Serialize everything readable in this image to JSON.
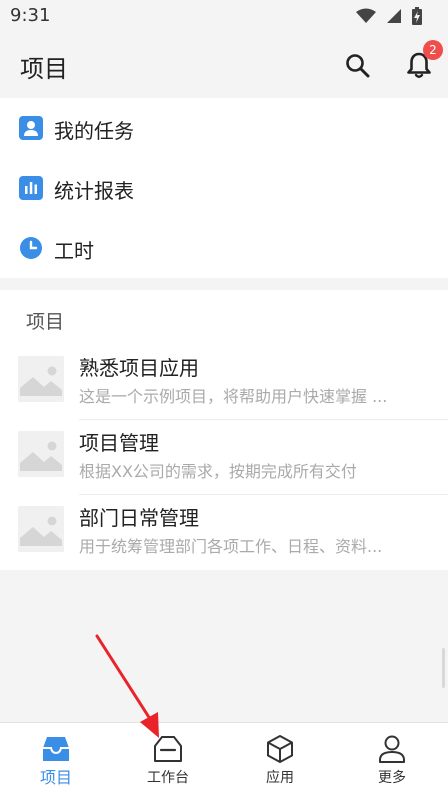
{
  "status_bar": {
    "time": "9:31"
  },
  "header": {
    "title": "项目",
    "notification_count": "2"
  },
  "menu": {
    "items": [
      {
        "label": "我的任务",
        "icon": "person-icon"
      },
      {
        "label": "统计报表",
        "icon": "bar-chart-icon"
      },
      {
        "label": "工时",
        "icon": "clock-icon"
      }
    ]
  },
  "projects": {
    "section_title": "项目",
    "items": [
      {
        "name": "熟悉项目应用",
        "description": "这是一个示例项目，将帮助用户快速掌握 ..."
      },
      {
        "name": "项目管理",
        "description": "根据XX公司的需求，按期完成所有交付"
      },
      {
        "name": "部门日常管理",
        "description": "用于统筹管理部门各项工作、日程、资料..."
      }
    ]
  },
  "bottom_nav": {
    "items": [
      {
        "label": "项目",
        "icon": "inbox-icon",
        "active": true
      },
      {
        "label": "工作台",
        "icon": "workbench-icon",
        "active": false
      },
      {
        "label": "应用",
        "icon": "cube-icon",
        "active": false
      },
      {
        "label": "更多",
        "icon": "user-icon",
        "active": false
      }
    ]
  },
  "colors": {
    "accent": "#3a8ee6",
    "badge": "#f04d4d",
    "annotation": "#e8232a"
  }
}
